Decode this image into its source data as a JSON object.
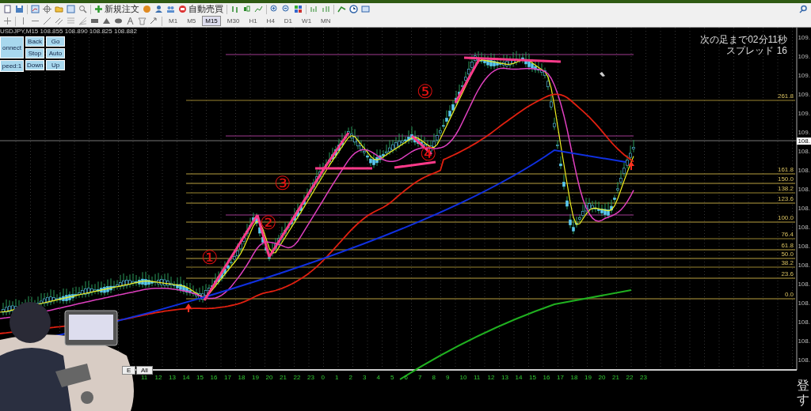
{
  "toolbar": {
    "order_button": "新規注文",
    "autotrade_button": "自動売買",
    "timeframes": [
      {
        "label": "M1",
        "selected": false
      },
      {
        "label": "M5",
        "selected": false
      },
      {
        "label": "M15",
        "selected": true
      },
      {
        "label": "M30",
        "selected": false
      },
      {
        "label": "H1",
        "selected": false
      },
      {
        "label": "H4",
        "selected": false
      },
      {
        "label": "D1",
        "selected": false
      },
      {
        "label": "W1",
        "selected": false
      },
      {
        "label": "MN",
        "selected": false
      }
    ]
  },
  "chart": {
    "header": "USDJPY,M15  108.855 108.890 108.825 108.882",
    "controls": [
      "onnect",
      "Back",
      "Go",
      "Stop",
      "Auto",
      "peed:1",
      "Down",
      "Up"
    ],
    "countdown": "次の足まで02分11秒",
    "spread": "スプレッド 16",
    "fib_levels": [
      "261.8",
      "161.8",
      "150.0",
      "138.2",
      "123.6",
      "100.0",
      "76.4",
      "61.8",
      "50.0",
      "38.2",
      "23.6",
      "0.0"
    ],
    "wave_labels": [
      "①",
      "②",
      "③",
      "④",
      "⑤"
    ],
    "price_axis": [
      "109.",
      "109.",
      "109.",
      "109.",
      "109.",
      "109.",
      "108.",
      "108.",
      "108.",
      "108.",
      "108.",
      "108.",
      "108.",
      "108.",
      "108.",
      "108.",
      "108.",
      "108."
    ],
    "current_price": "108.",
    "period_buttons": [
      "E",
      "All"
    ],
    "hours": [
      "11",
      "12",
      "13",
      "14",
      "15",
      "16",
      "17",
      "18",
      "19",
      "20",
      "21",
      "22",
      "23",
      "0",
      "1",
      "2",
      "3",
      "4",
      "5",
      "6",
      "7",
      "8",
      "9",
      "10",
      "11",
      "12",
      "13",
      "14",
      "15",
      "16",
      "17",
      "18",
      "19",
      "20",
      "21",
      "22",
      "23"
    ]
  },
  "caption": "登す"
}
